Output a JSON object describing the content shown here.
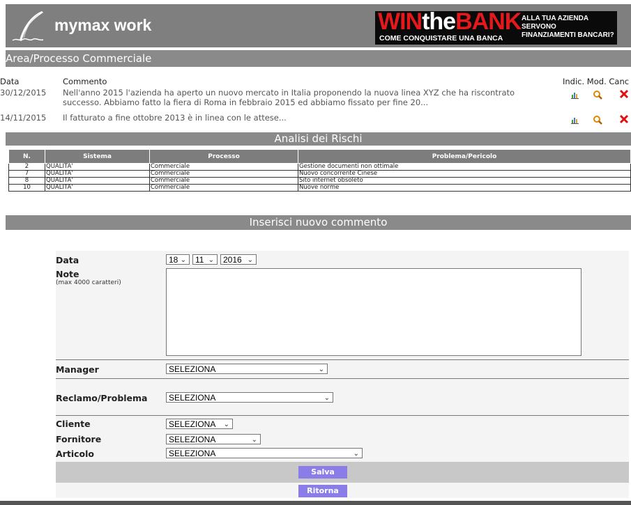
{
  "header": {
    "app_title": "mymax work",
    "banner": {
      "win": "WIN",
      "the": "the",
      "bank": "BANK",
      "subtitle": "COME CONQUISTARE UNA BANCA",
      "right_line1": "ALLA TUA AZIENDA",
      "right_line2": "SERVONO",
      "right_line3": "FINANZIAMENTI BANCARI?"
    }
  },
  "area_title": "Area/Processo Commerciale",
  "comments": {
    "headers": {
      "data": "Data",
      "commento": "Commento",
      "actions": "Indic. Mod. Canc"
    },
    "rows": [
      {
        "date": "30/12/2015",
        "text": "Nell'anno 2015 l'azienda ha aperto un nuovo mercato in Italia proponendo la nuova linea XYZ che ha riscontrato successo. Abbiamo fatto la fiera di Roma in febbraio 2015 ed abbiamo fissato per fine 20..."
      },
      {
        "date": "14/11/2015",
        "text": "Il fatturato a fine ottobre 2013 è in linea con le attese..."
      }
    ]
  },
  "rischi": {
    "title": "Analisi dei Rischi",
    "columns": [
      "N.",
      "Sistema",
      "Processo",
      "Problema/Pericolo"
    ],
    "rows": [
      [
        "2",
        "QUALITA'",
        "Commerciale",
        "Gestione documenti non ottimale"
      ],
      [
        "7",
        "QUALITA'",
        "Commerciale",
        "Nuovo concorrente Cinese"
      ],
      [
        "8",
        "QUALITA'",
        "Commerciale",
        "Sito internet obsoleto"
      ],
      [
        "10",
        "QUALITA'",
        "Commerciale",
        "Nuove norme"
      ]
    ]
  },
  "form": {
    "title": "Inserisci nuovo commento",
    "data_label": "Data",
    "day": "18",
    "month": "11",
    "year": "2016",
    "note_label": "Note",
    "note_hint": "(max 4000 caratteri)",
    "manager_label": "Manager",
    "manager_value": "SELEZIONA",
    "reclamo_label": "Reclamo/Problema",
    "reclamo_value": "SELEZIONA",
    "cliente_label": "Cliente",
    "cliente_value": "SELEZIONA",
    "fornitore_label": "Fornitore",
    "fornitore_value": "SELEZIONA",
    "articolo_label": "Articolo",
    "articolo_value": "SELEZIONA",
    "save_label": "Salva",
    "back_label": "Ritorna"
  },
  "colors": {
    "header_gray": "#7f7f7f",
    "button_purple": "#8b7de8",
    "banner_red": "#e3191b"
  },
  "icons": [
    "logo-quill-icon",
    "bar-chart-icon",
    "magnifier-icon",
    "delete-x-icon",
    "chevron-down-icon"
  ]
}
